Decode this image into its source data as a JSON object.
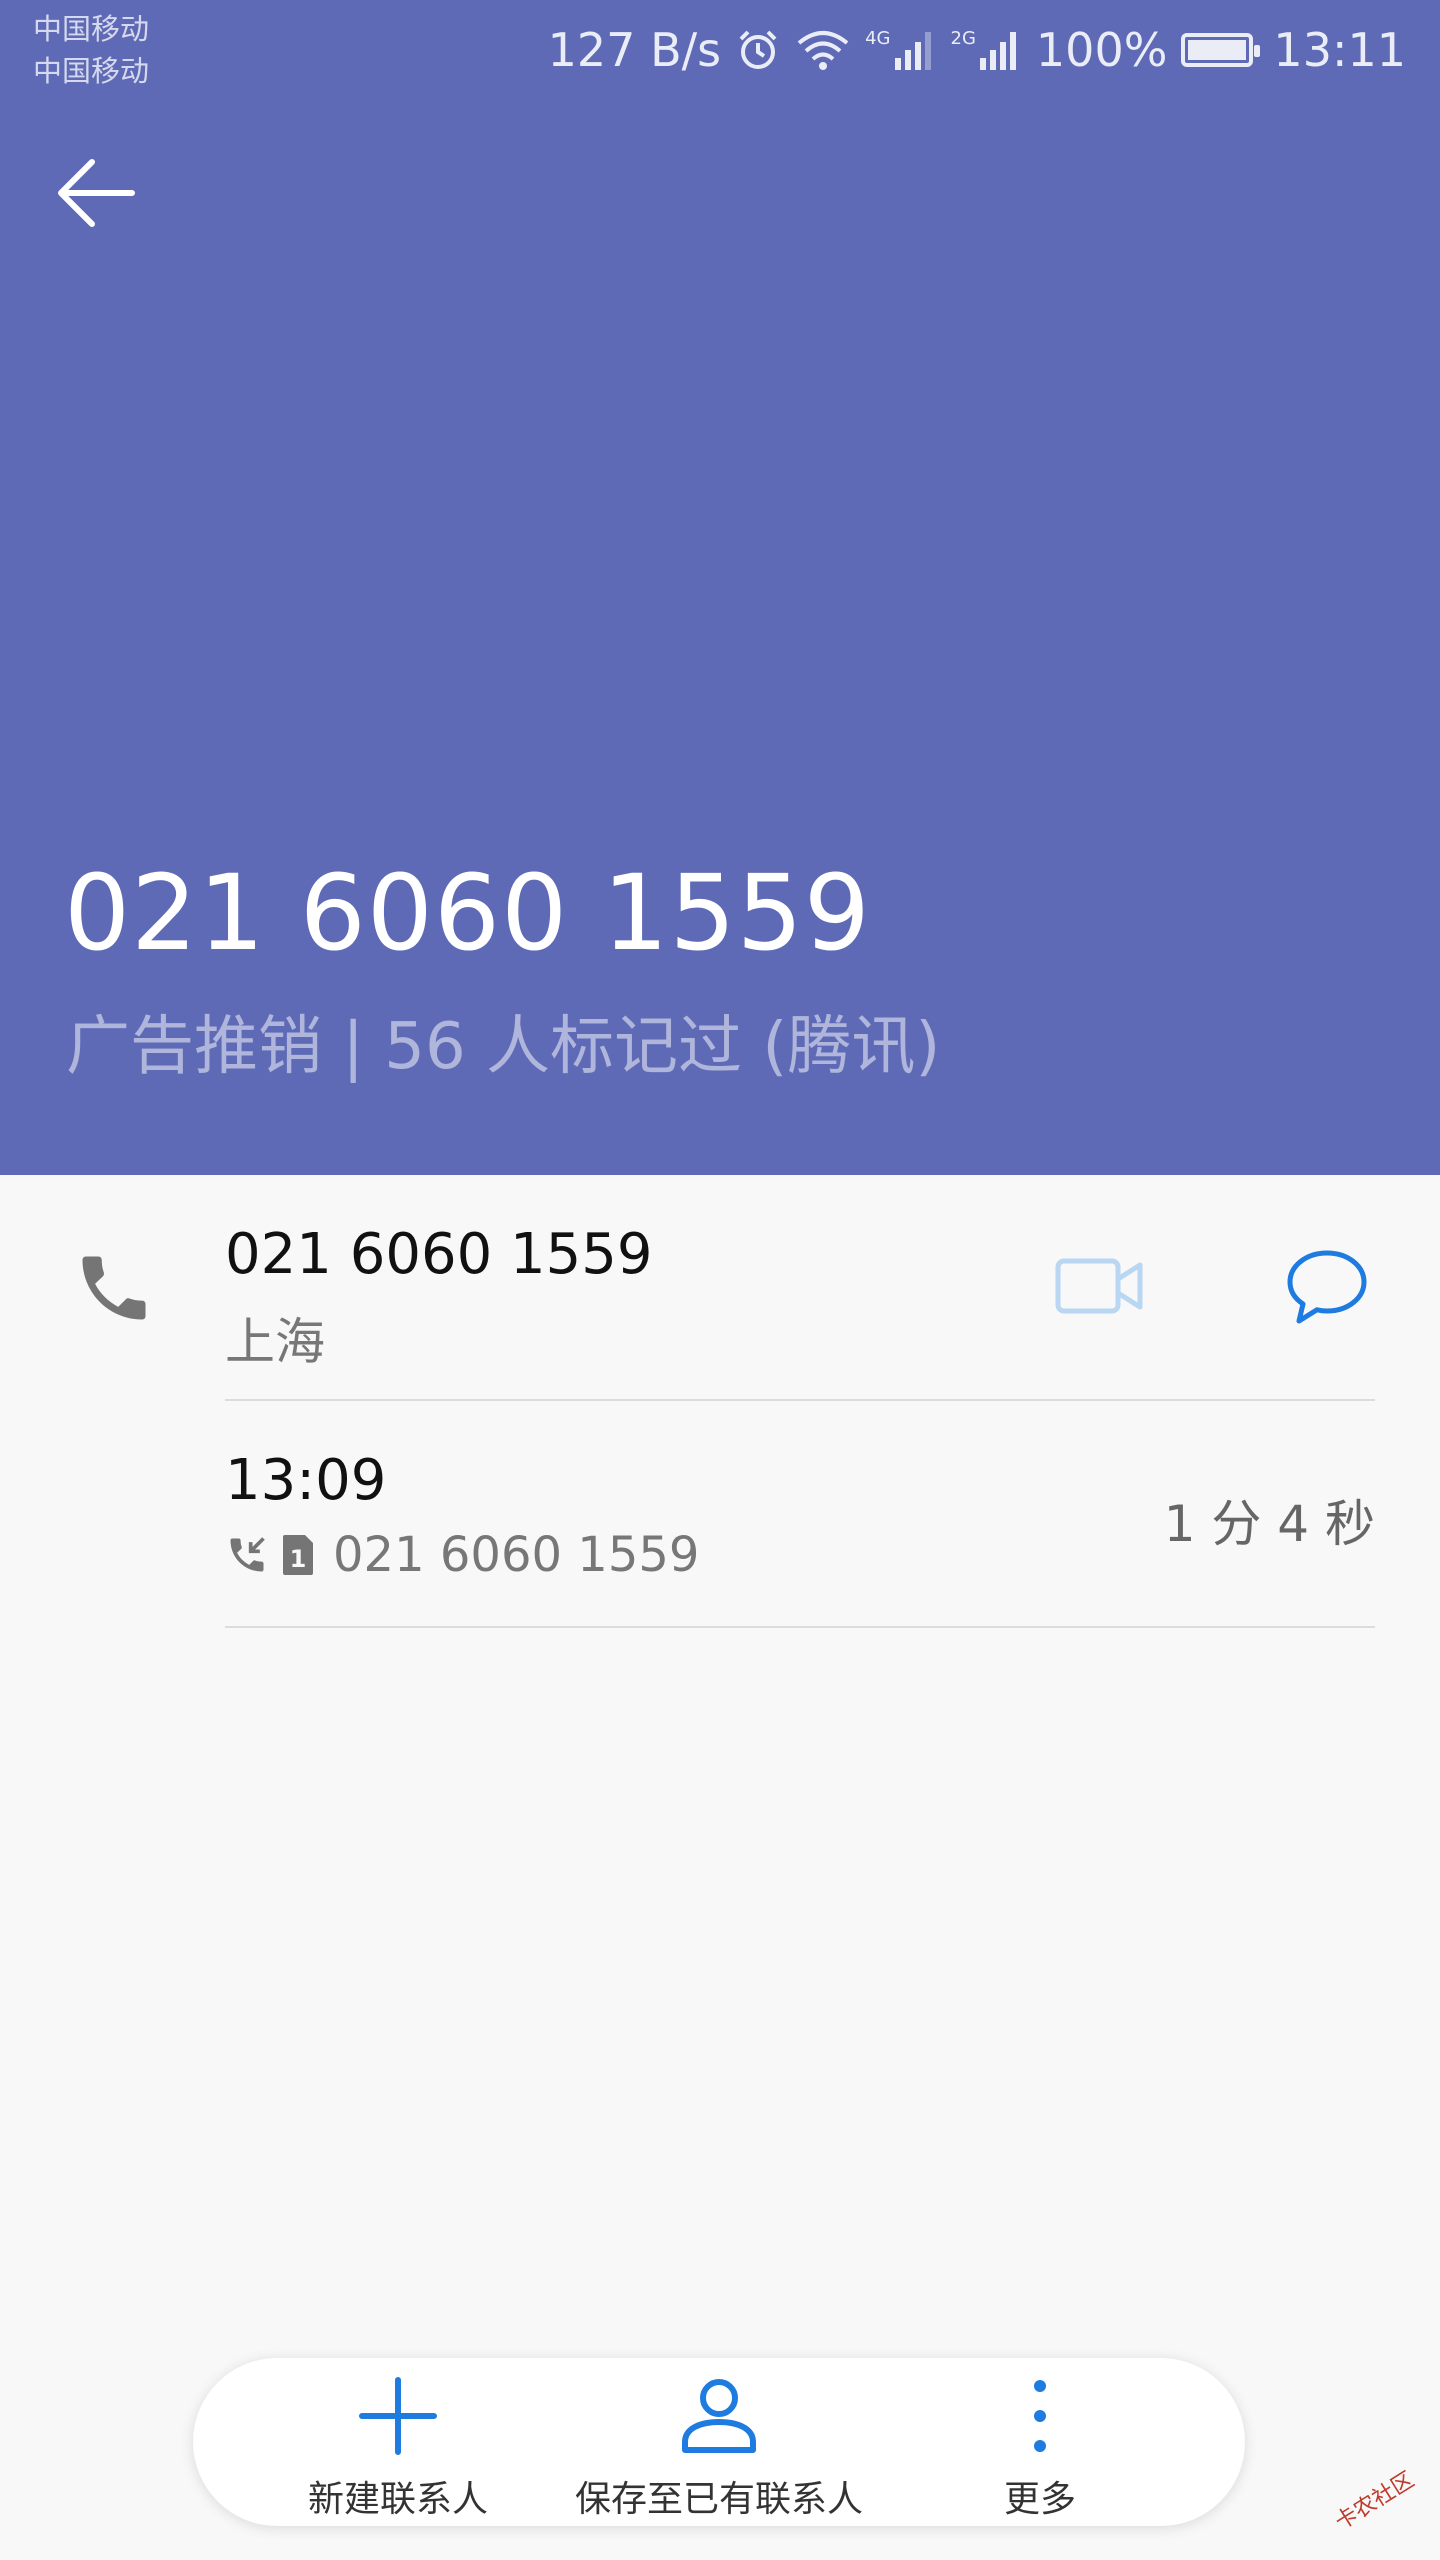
{
  "status_bar": {
    "carrier_1": "中国移动",
    "carrier_2": "中国移动",
    "net_speed": "127 B/s",
    "sim1_network": "4G",
    "sim2_network": "2G",
    "battery": "100%",
    "time": "13:11",
    "icons": [
      "alarm-icon",
      "wifi-icon",
      "signal-icon",
      "battery-icon"
    ]
  },
  "header": {
    "number": "021 6060 1559",
    "tag": "广告推销 | 56 人标记过 (腾讯)",
    "background": "#5e6ab6"
  },
  "contact_row": {
    "number": "021 6060 1559",
    "location": "上海"
  },
  "call_log": {
    "time": "13:09",
    "sim": "1",
    "number": "021 6060 1559",
    "duration": "1 分 4 秒"
  },
  "bottom_bar": {
    "new_contact": "新建联系人",
    "save_existing": "保存至已有联系人",
    "more": "更多"
  },
  "watermark": "卡农社区",
  "colors": {
    "accent": "#1e7be0",
    "video_disabled": "#b9d6f2"
  }
}
